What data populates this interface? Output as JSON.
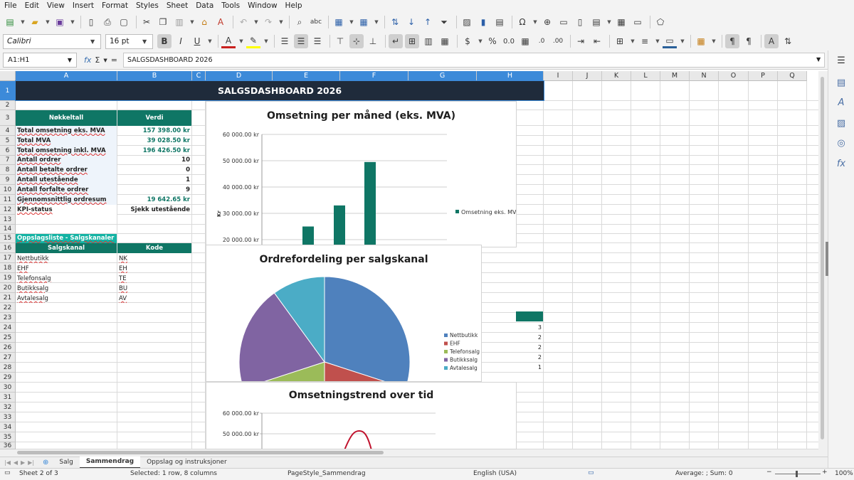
{
  "menu": [
    "File",
    "Edit",
    "View",
    "Insert",
    "Format",
    "Styles",
    "Sheet",
    "Data",
    "Tools",
    "Window",
    "Help"
  ],
  "toolbar": {
    "font_name": "Calibri",
    "font_size": "16 pt"
  },
  "formula_bar": {
    "name_box": "A1:H1",
    "content": "SALGSDASHBOARD 2026"
  },
  "columns": [
    "A",
    "B",
    "C",
    "D",
    "E",
    "F",
    "G",
    "H",
    "I",
    "J",
    "K",
    "L",
    "M",
    "N",
    "O",
    "P",
    "Q"
  ],
  "rows": [
    "1",
    "2",
    "3",
    "4",
    "5",
    "6",
    "7",
    "8",
    "9",
    "10",
    "11",
    "12",
    "13",
    "14",
    "15",
    "16",
    "17",
    "18",
    "19",
    "20",
    "21",
    "22",
    "23",
    "24",
    "25",
    "26",
    "27",
    "28",
    "29",
    "30",
    "31",
    "32",
    "33",
    "34",
    "35",
    "36"
  ],
  "sheet": {
    "title": "SALGSDASHBOARD 2026",
    "kpi_header": {
      "label": "Nøkkeltall",
      "value": "Verdi"
    },
    "kpis": [
      {
        "label": "Total omsetning eks. MVA",
        "value": "157 398.00 kr"
      },
      {
        "label": "Total MVA",
        "value": "39 028.50 kr"
      },
      {
        "label": "Total omsetning inkl. MVA",
        "value": "196 426.50 kr"
      },
      {
        "label": "Antall ordrer",
        "value": "10"
      },
      {
        "label": "Antall betalte ordrer",
        "value": "0"
      },
      {
        "label": "Antall utestående",
        "value": "1"
      },
      {
        "label": "Antall forfalte ordrer",
        "value": "9"
      },
      {
        "label": "Gjennomsnittlig ordresum",
        "value": "19 642.65 kr"
      },
      {
        "label": "KPI-status",
        "value": "Sjekk utestående"
      }
    ],
    "lookup_title": "Oppslagsliste - Salgskanaler",
    "lookup_header": {
      "label": "Salgskanal",
      "value": "Kode"
    },
    "lookup": [
      {
        "label": "Nettbutikk",
        "value": "NK"
      },
      {
        "label": "EHF",
        "value": "EH"
      },
      {
        "label": "Telefonsalg",
        "value": "TE"
      },
      {
        "label": "Butikksalg",
        "value": "BU"
      },
      {
        "label": "Avtalesalg",
        "value": "AV"
      }
    ],
    "h_column_values": [
      "3",
      "2",
      "2",
      "2",
      "1"
    ]
  },
  "chart_data": [
    {
      "type": "bar",
      "title": "Omsetning per måned (eks. MVA)",
      "ylabel": "Kr",
      "ylim": [
        0,
        60000
      ],
      "yticks": [
        "60 000.00 kr",
        "50 000.00 kr",
        "40 000.00 kr",
        "30 000.00 kr",
        "20 000.00 kr"
      ],
      "series": [
        {
          "name": "Omsetning eks. MVA",
          "values": [
            25000,
            33000,
            49500
          ]
        }
      ],
      "color": "#0f7665",
      "legend": "right"
    },
    {
      "type": "pie",
      "title": "Ordrefordeling per salgskanal",
      "categories": [
        "Nettbutikk",
        "EHF",
        "Telefonsalg",
        "Butikksalg",
        "Avtalesalg"
      ],
      "values": [
        3,
        2,
        2,
        2,
        1
      ],
      "colors": [
        "#4f81bd",
        "#c0504d",
        "#9bbb59",
        "#8064a2",
        "#4bacc6"
      ],
      "legend": "right"
    },
    {
      "type": "line",
      "title": "Omsetningstrend over tid",
      "ylim": [
        0,
        60000
      ],
      "yticks": [
        "60 000.00 kr",
        "50 000.00 kr"
      ],
      "color": "#c0122d"
    }
  ],
  "tabs": [
    "Salg",
    "Sammendrag",
    "Oppslag og instruksjoner"
  ],
  "status": {
    "sheet": "Sheet 2 of 3",
    "selection": "Selected: 1 row, 8 columns",
    "page_style": "PageStyle_Sammendrag",
    "language": "English (USA)",
    "summary": "Average: ; Sum: 0",
    "zoom": "100%"
  }
}
